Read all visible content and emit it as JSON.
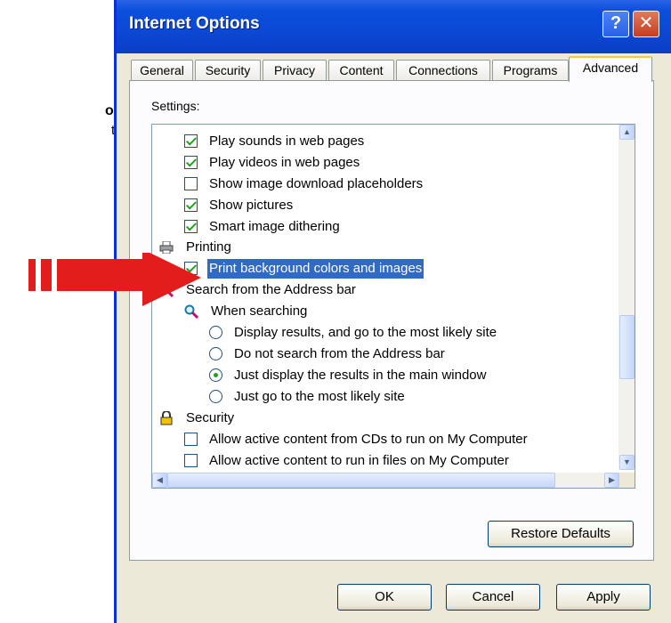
{
  "note": {
    "line1": "ons…",
    "line2": "tab"
  },
  "window": {
    "title": "Internet Options",
    "help": "?",
    "close": "✕"
  },
  "tabs": [
    {
      "label": "General"
    },
    {
      "label": "Security"
    },
    {
      "label": "Privacy"
    },
    {
      "label": "Content"
    },
    {
      "label": "Connections"
    },
    {
      "label": "Programs"
    },
    {
      "label": "Advanced"
    }
  ],
  "settings_label": "Settings:",
  "items": [
    {
      "text": "Play sounds in web pages"
    },
    {
      "text": "Play videos in web pages"
    },
    {
      "text": "Show image download placeholders"
    },
    {
      "text": "Show pictures"
    },
    {
      "text": "Smart image dithering"
    },
    {
      "text": "Printing"
    },
    {
      "text": "Print background colors and images"
    },
    {
      "text": "Search from the Address bar"
    },
    {
      "text": "When searching"
    },
    {
      "text": "Display results, and go to the most likely site"
    },
    {
      "text": "Do not search from the Address bar"
    },
    {
      "text": "Just display the results in the main window"
    },
    {
      "text": "Just go to the most likely site"
    },
    {
      "text": "Security"
    },
    {
      "text": "Allow active content from CDs to run on My Computer"
    },
    {
      "text": "Allow active content to run in files on My Computer"
    }
  ],
  "buttons": {
    "restore": "Restore Defaults",
    "ok": "OK",
    "cancel": "Cancel",
    "apply": "Apply"
  },
  "colors": {
    "highlight": "#316ac5",
    "arrow": "#e31c1c",
    "titlebar": "#0a4fdc"
  }
}
